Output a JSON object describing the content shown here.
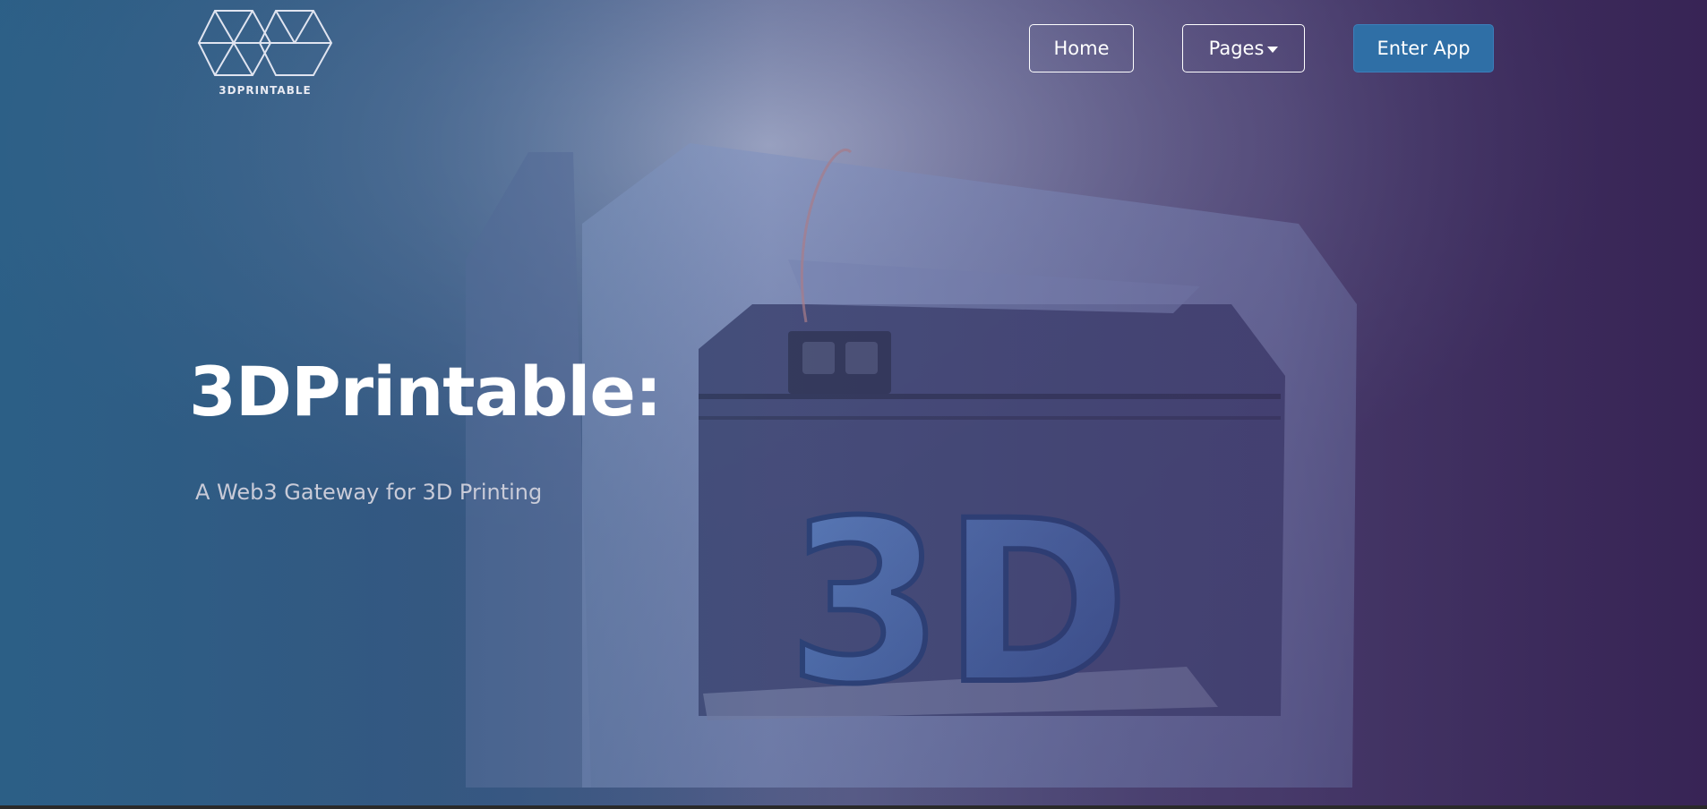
{
  "brand": {
    "logo_text": "3DPRINTABLE"
  },
  "nav": {
    "home_label": "Home",
    "pages_label": "Pages",
    "enter_app_label": "Enter App"
  },
  "hero": {
    "title": "3DPrintable:",
    "subtitle": "A Web3 Gateway for 3D Printing",
    "image_text": "3D"
  },
  "colors": {
    "accent_button": "#2f6fa6",
    "gradient_left": "#2d5a7e",
    "gradient_right": "#3a2a55"
  },
  "icons": {
    "logo": "hexagon-cubes-logo",
    "dropdown": "caret-down-icon"
  }
}
